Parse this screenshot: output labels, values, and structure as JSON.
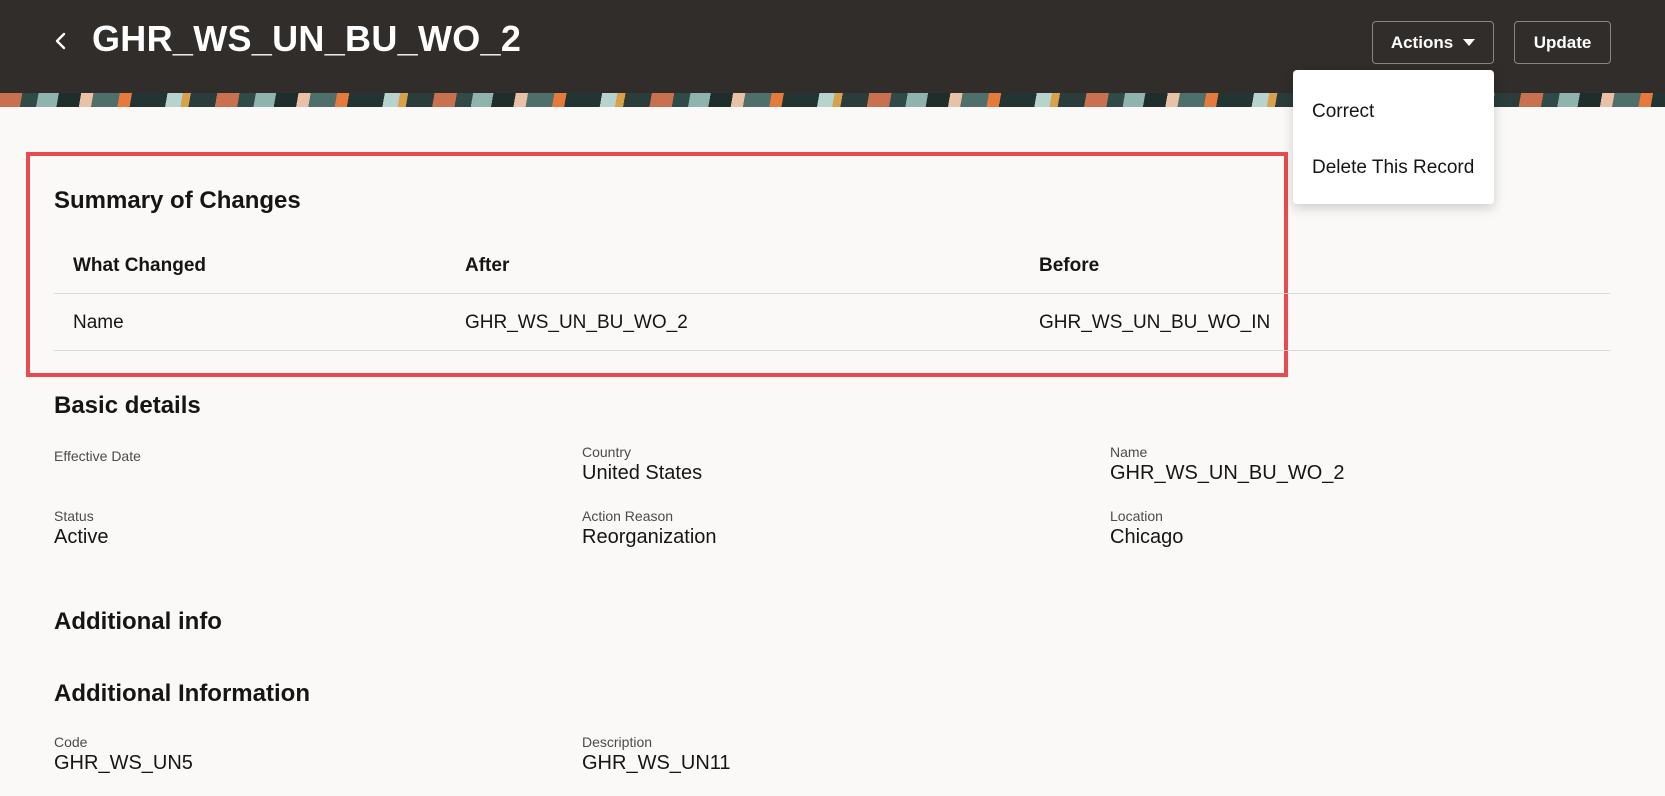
{
  "header": {
    "title": "GHR_WS_UN_BU_WO_2",
    "actions_label": "Actions",
    "update_label": "Update"
  },
  "actions_menu": {
    "items": [
      "Correct",
      "Delete This Record"
    ]
  },
  "summary": {
    "title": "Summary of Changes",
    "columns": [
      "What Changed",
      "After",
      "Before"
    ],
    "rows": [
      [
        "Name",
        "GHR_WS_UN_BU_WO_2",
        "GHR_WS_UN_BU_WO_IN"
      ]
    ]
  },
  "basic": {
    "title": "Basic details",
    "effective_date_label": "Effective Date",
    "country_label": "Country",
    "country_value": "United States",
    "name_label": "Name",
    "name_value": "GHR_WS_UN_BU_WO_2",
    "status_label": "Status",
    "status_value": "Active",
    "action_reason_label": "Action Reason",
    "action_reason_value": "Reorganization",
    "location_label": "Location",
    "location_value": "Chicago"
  },
  "additional_info": {
    "title": "Additional info"
  },
  "additional_information": {
    "title": "Additional Information",
    "code_label": "Code",
    "code_value": "GHR_WS_UN5",
    "description_label": "Description",
    "description_value": "GHR_WS_UN11"
  },
  "colors": {
    "header_bg": "#312d2a",
    "highlight_border": "#e94a4f",
    "page_bg": "#faf9f7"
  }
}
